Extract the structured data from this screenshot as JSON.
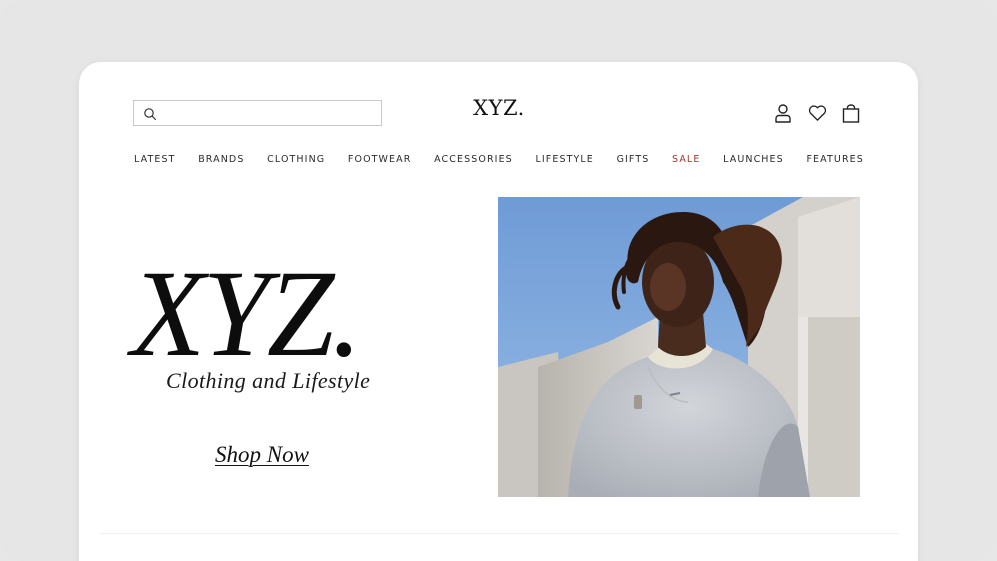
{
  "header": {
    "logo": "XYZ.",
    "search": {
      "value": "",
      "placeholder": ""
    },
    "icons": [
      "account-icon",
      "wishlist-heart-icon",
      "shopping-bag-icon"
    ]
  },
  "nav": {
    "items": [
      {
        "label": "LATEST"
      },
      {
        "label": "BRANDS"
      },
      {
        "label": "CLOTHING"
      },
      {
        "label": "FOOTWEAR"
      },
      {
        "label": "ACCESSORIES"
      },
      {
        "label": "LIFESTYLE"
      },
      {
        "label": "GIFTS"
      },
      {
        "label": "SALE"
      },
      {
        "label": "LAUNCHES"
      },
      {
        "label": "FEATURES"
      }
    ]
  },
  "hero": {
    "title": "XYZ.",
    "subtitle": "Clothing and Lifestyle",
    "cta": "Shop Now"
  },
  "colors": {
    "sale": "#a13430",
    "sky": "#7ea6d8",
    "text": "#111111"
  }
}
